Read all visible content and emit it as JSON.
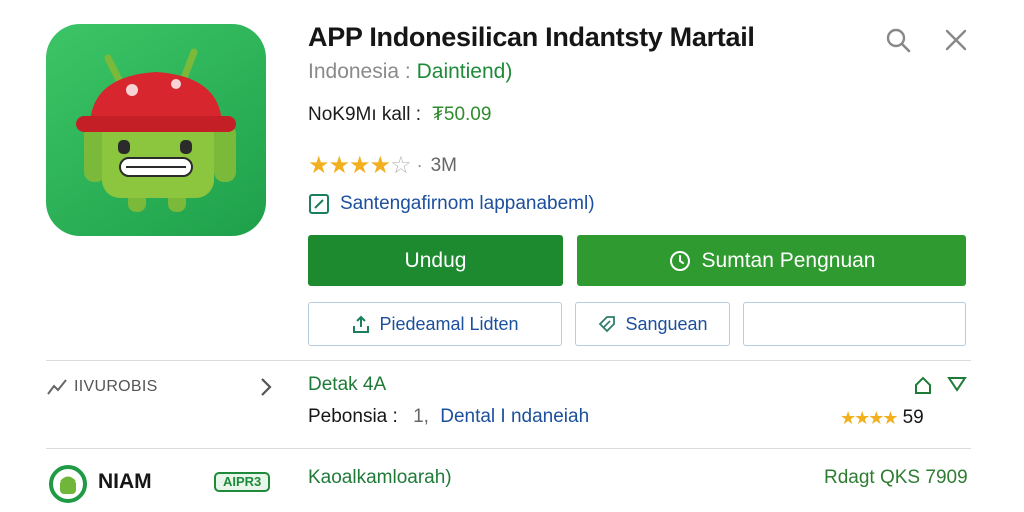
{
  "app": {
    "title": "APP Indonesilican Indantsty Martail",
    "country": "Indonesia",
    "separator": ":",
    "developer": "Daintiend)",
    "price_label": "NoK9Mı kall :",
    "price_value": "₮50.09",
    "rating_value": 4,
    "rating_max": 5,
    "rating_dot": "·",
    "rating_count": "3M",
    "notice": "Santengafirnom lappanabeml)",
    "icon": "android-robot-red-cap-icon"
  },
  "toolbar": {
    "search_icon": "search-icon",
    "close_icon": "close-icon"
  },
  "actions": {
    "install_label": "Undug",
    "wishlist_label": "Sumtan Pengnuan",
    "share_label": "Piedeamal Lidten",
    "save_label": "Sanguean",
    "empty_label": ""
  },
  "info": {
    "section_label": "IIVUROBIS",
    "detail_title": "Detak 4A",
    "detail_key": "Pebonsia :",
    "detail_num": "1,",
    "detail_value": "Dental I ndaneiah",
    "mini_rating_stars": 4,
    "mini_rating_value": "59"
  },
  "developer_row": {
    "name": "NIAM",
    "badge": "AIPR3",
    "title": "Kaoalkamloarah)",
    "meta": "Rdagt QKS 7909"
  },
  "colors": {
    "accent_green": "#1d8a30",
    "secondary_green": "#2f9a2f",
    "link_blue": "#1c4f9c",
    "star": "#f2b01e"
  }
}
